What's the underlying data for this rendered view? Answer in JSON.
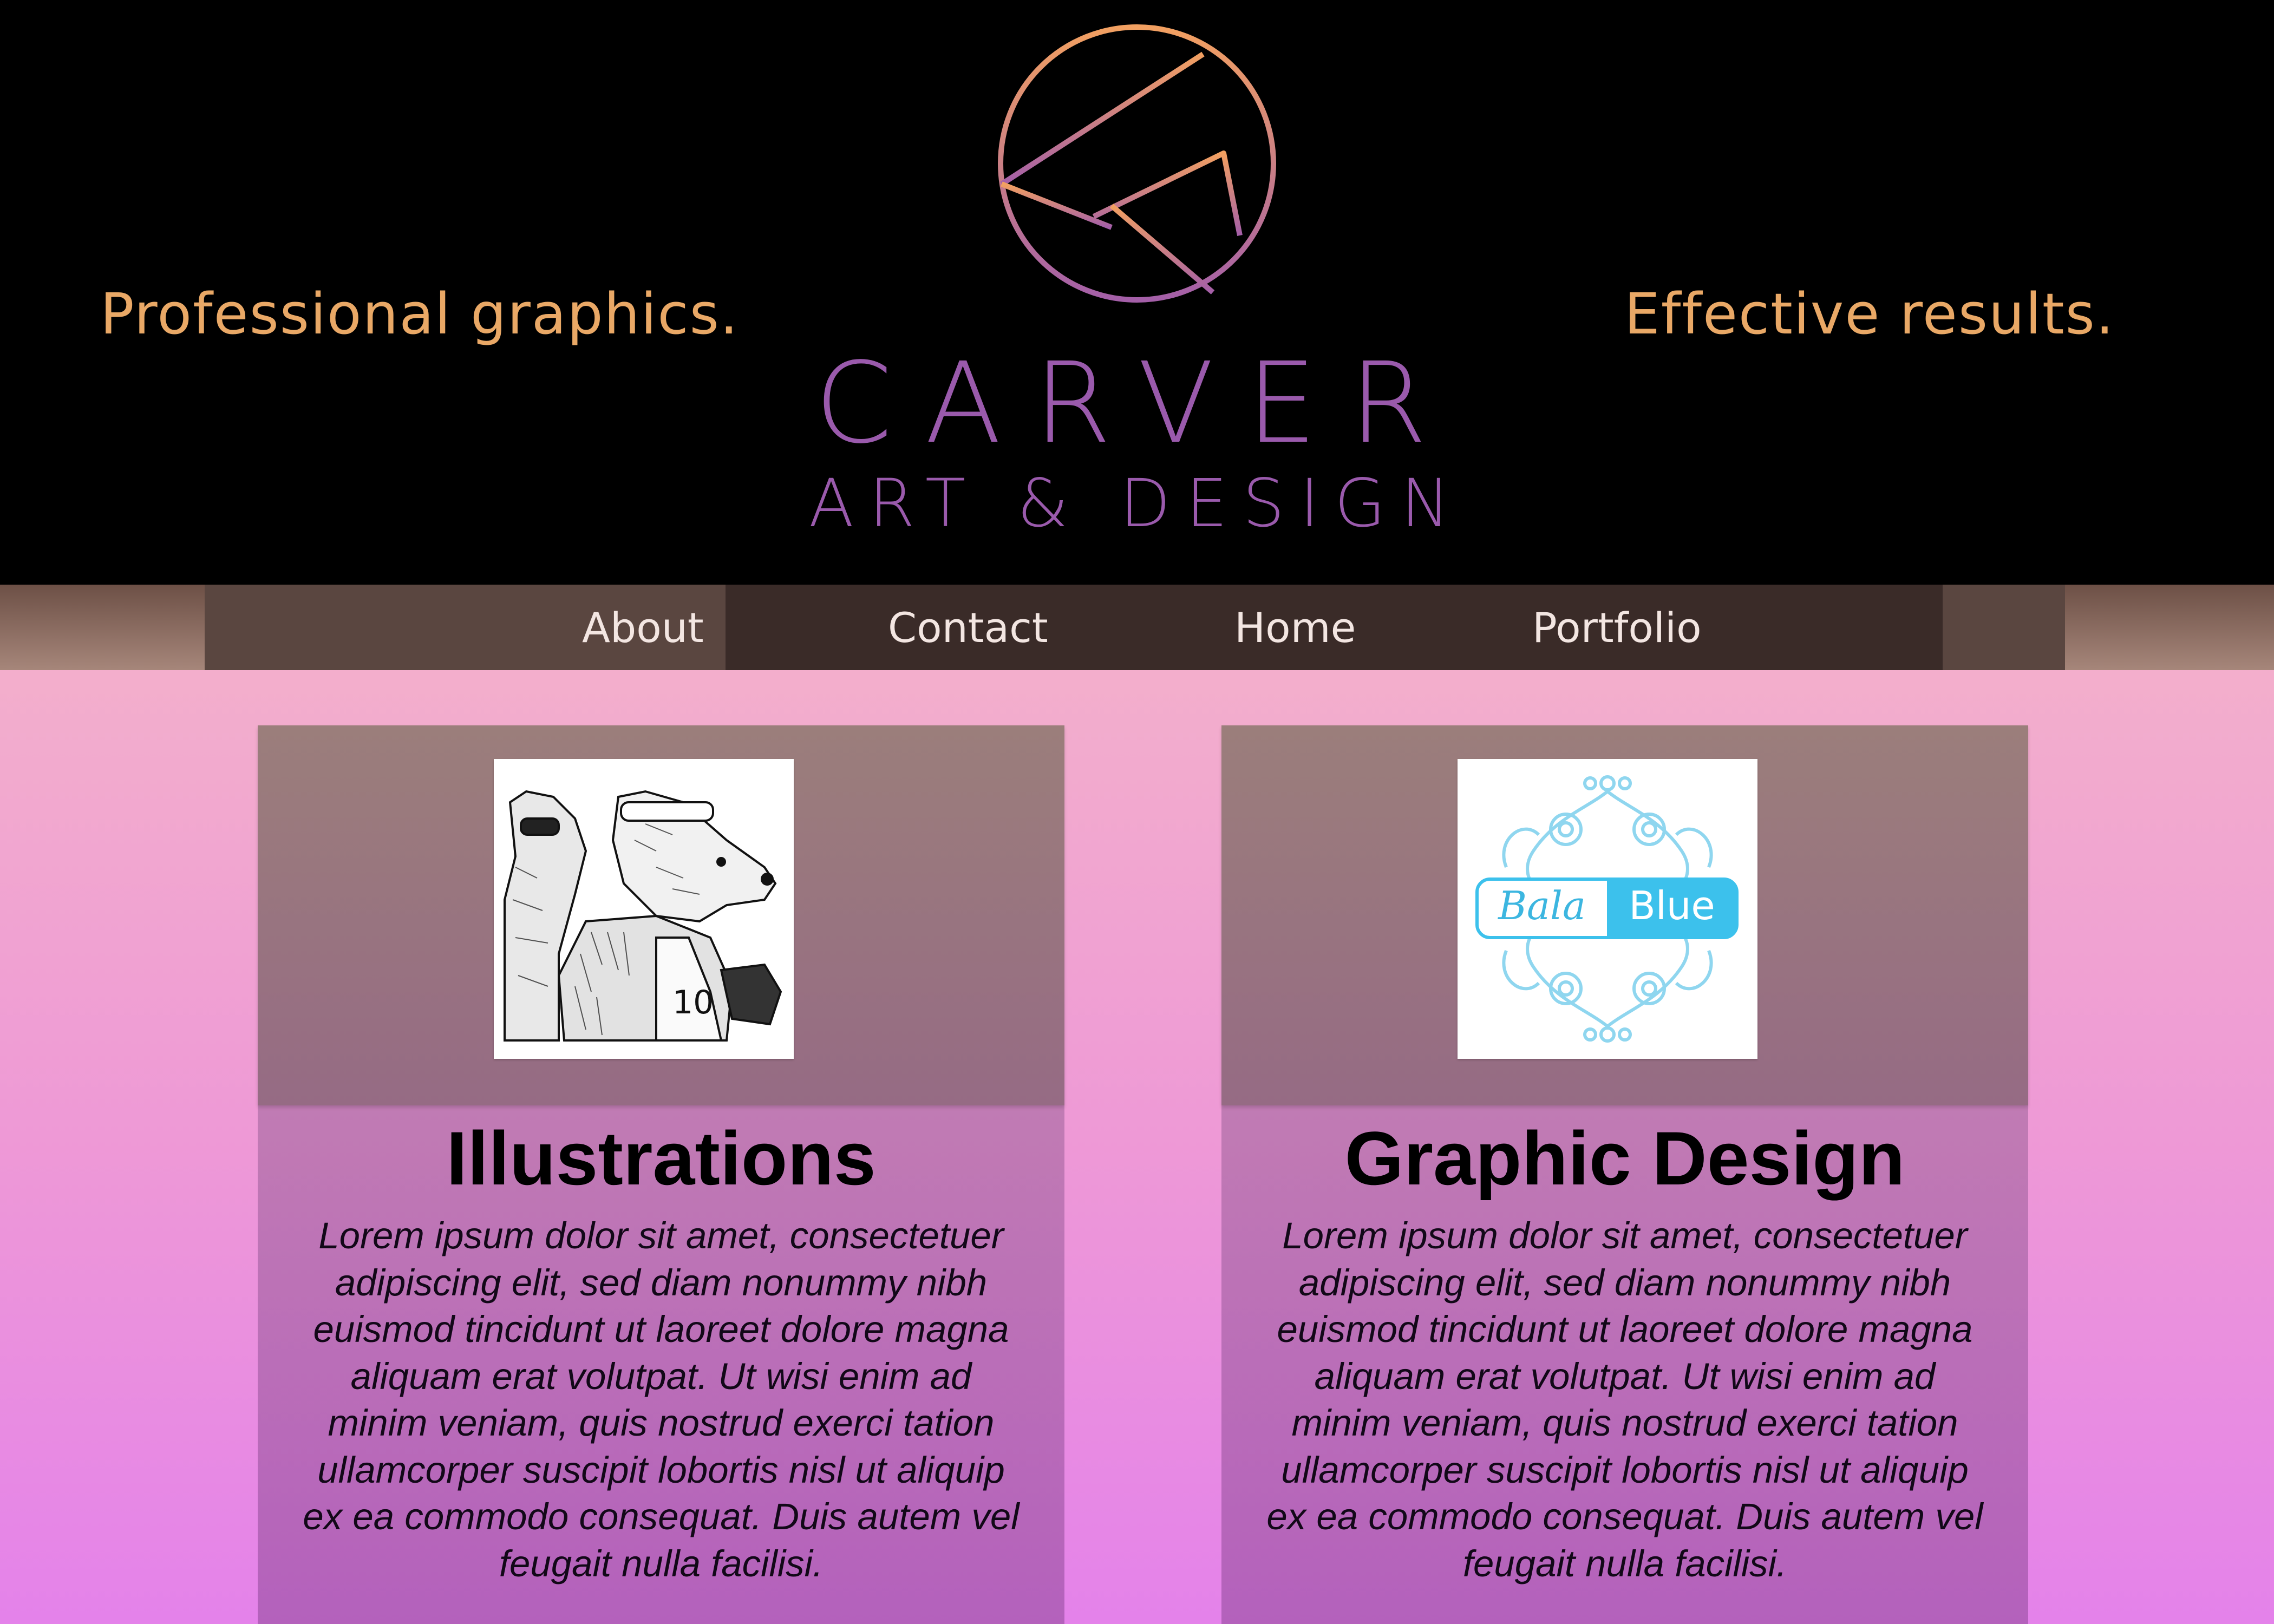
{
  "header": {
    "tagline_left": "Professional graphics.",
    "tagline_right": "Effective results.",
    "brand_name": "CARVER",
    "brand_sub": "ART & DESIGN",
    "logo_icon": "geometric-k-circle-logo",
    "colors": {
      "tagline": "#e9a866",
      "brand": "#9a5aac",
      "logo_gradient_start": "#f2a061",
      "logo_gradient_end": "#a45fa8"
    }
  },
  "nav": {
    "items": [
      {
        "label": "About"
      },
      {
        "label": "Contact"
      },
      {
        "label": "Home"
      },
      {
        "label": "Portfolio"
      }
    ]
  },
  "cards": [
    {
      "title": "Illustrations",
      "image": "bear-runner-illustration",
      "body": "Lorem ipsum dolor sit amet, consectetuer adipiscing elit, sed diam nonummy nibh euismod tincidunt ut laoreet dolore magna aliquam erat volutpat. Ut wisi enim ad minim veniam, quis nostrud exerci tation ullamcorper suscipit lobortis nisl ut aliquip ex ea commodo consequat. Duis autem vel feugait nulla facilisi."
    },
    {
      "title": "Graphic Design",
      "image": "bala-blue-logo",
      "image_text_script": "Bala",
      "image_text_box": "Blue",
      "body": "Lorem ipsum dolor sit amet, consectetuer adipiscing elit, sed diam nonummy nibh euismod tincidunt ut laoreet dolore magna aliquam erat volutpat. Ut wisi enim ad minim veniam, quis nostrud exerci tation ullamcorper suscipit lobortis nisl ut aliquip ex ea commodo consequat. Duis autem vel feugait nulla facilisi."
    }
  ]
}
